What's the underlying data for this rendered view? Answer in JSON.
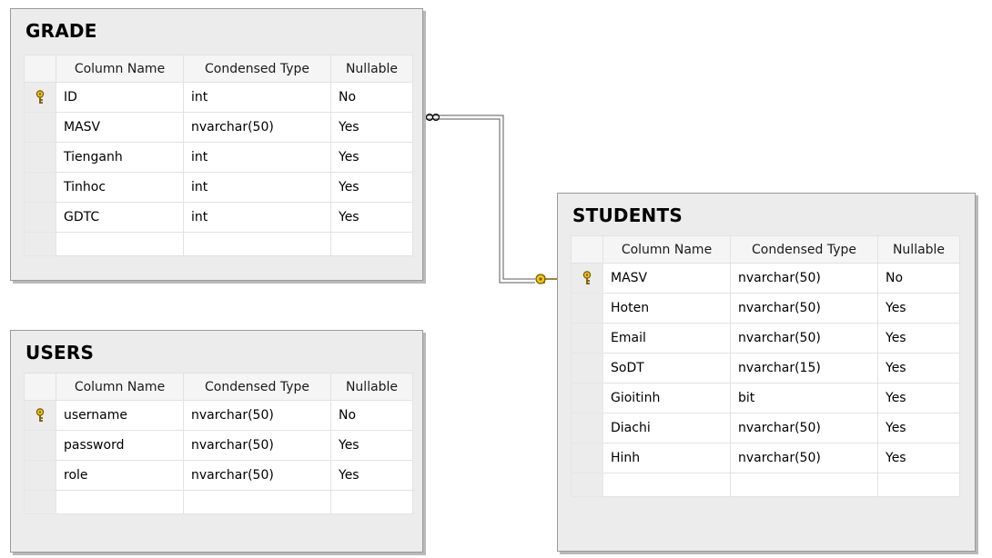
{
  "tables": [
    {
      "title": "GRADE",
      "headers": [
        "Column Name",
        "Condensed Type",
        "Nullable"
      ],
      "rows": [
        {
          "key": true,
          "name": "ID",
          "type": "int",
          "nullable": "No"
        },
        {
          "key": false,
          "name": "MASV",
          "type": "nvarchar(50)",
          "nullable": "Yes"
        },
        {
          "key": false,
          "name": "Tienganh",
          "type": "int",
          "nullable": "Yes"
        },
        {
          "key": false,
          "name": "Tinhoc",
          "type": "int",
          "nullable": "Yes"
        },
        {
          "key": false,
          "name": "GDTC",
          "type": "int",
          "nullable": "Yes"
        }
      ]
    },
    {
      "title": "USERS",
      "headers": [
        "Column Name",
        "Condensed Type",
        "Nullable"
      ],
      "rows": [
        {
          "key": true,
          "name": "username",
          "type": "nvarchar(50)",
          "nullable": "No"
        },
        {
          "key": false,
          "name": "password",
          "type": "nvarchar(50)",
          "nullable": "Yes"
        },
        {
          "key": false,
          "name": "role",
          "type": "nvarchar(50)",
          "nullable": "Yes"
        }
      ]
    },
    {
      "title": "STUDENTS",
      "headers": [
        "Column Name",
        "Condensed Type",
        "Nullable"
      ],
      "rows": [
        {
          "key": true,
          "name": "MASV",
          "type": "nvarchar(50)",
          "nullable": "No"
        },
        {
          "key": false,
          "name": "Hoten",
          "type": "nvarchar(50)",
          "nullable": "Yes"
        },
        {
          "key": false,
          "name": "Email",
          "type": "nvarchar(50)",
          "nullable": "Yes"
        },
        {
          "key": false,
          "name": "SoDT",
          "type": "nvarchar(15)",
          "nullable": "Yes"
        },
        {
          "key": false,
          "name": "Gioitinh",
          "type": "bit",
          "nullable": "Yes"
        },
        {
          "key": false,
          "name": "Diachi",
          "type": "nvarchar(50)",
          "nullable": "Yes"
        },
        {
          "key": false,
          "name": "Hinh",
          "type": "nvarchar(50)",
          "nullable": "Yes"
        }
      ]
    }
  ],
  "relationship": {
    "from_table": "GRADE",
    "to_table": "STUDENTS",
    "from_end": "infinity-icon",
    "to_end": "key-icon"
  },
  "colors": {
    "key_fill": "#f0c814",
    "key_stroke": "#7a5a00",
    "box_bg": "#ececec",
    "line": "#5a5a5a"
  }
}
